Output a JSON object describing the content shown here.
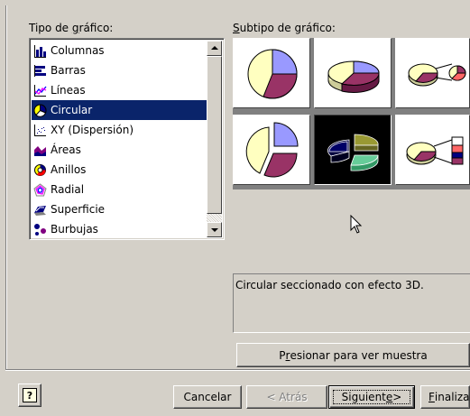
{
  "labels": {
    "chart_type": "Tipo de gráfico:",
    "chart_type_accel": "g",
    "subtype": "Subtipo de gráfico:",
    "subtype_accel": "S"
  },
  "chart_types": [
    {
      "label": "Columnas",
      "icon": "column-chart-icon"
    },
    {
      "label": "Barras",
      "icon": "bar-chart-icon"
    },
    {
      "label": "Líneas",
      "icon": "line-chart-icon"
    },
    {
      "label": "Circular",
      "icon": "pie-chart-icon",
      "selected": true
    },
    {
      "label": "XY (Dispersión)",
      "icon": "scatter-chart-icon"
    },
    {
      "label": "Áreas",
      "icon": "area-chart-icon"
    },
    {
      "label": "Anillos",
      "icon": "doughnut-chart-icon"
    },
    {
      "label": "Radial",
      "icon": "radar-chart-icon"
    },
    {
      "label": "Superficie",
      "icon": "surface-chart-icon"
    },
    {
      "label": "Burbujas",
      "icon": "bubble-chart-icon"
    }
  ],
  "subtypes": [
    {
      "name": "pie"
    },
    {
      "name": "pie-3d"
    },
    {
      "name": "pie-of-pie"
    },
    {
      "name": "exploded-pie"
    },
    {
      "name": "exploded-pie-3d",
      "selected": true
    },
    {
      "name": "bar-of-pie"
    }
  ],
  "description": "Circular seccionado con efecto 3D.",
  "preview_button": {
    "before": "P",
    "accel": "r",
    "after": "esionar para ver muestra"
  },
  "buttons": {
    "cancel": "Cancelar",
    "back": "< Atrás",
    "next_before": "Siguient",
    "next_accel": "e",
    "next_after": " >",
    "finish_accel": "F",
    "finish_after": "inaliza"
  },
  "colors": {
    "selection": "#0a246a",
    "pie_yellow": "#ffffc0",
    "pie_maroon": "#993366",
    "pie_lavender": "#9999ff"
  }
}
